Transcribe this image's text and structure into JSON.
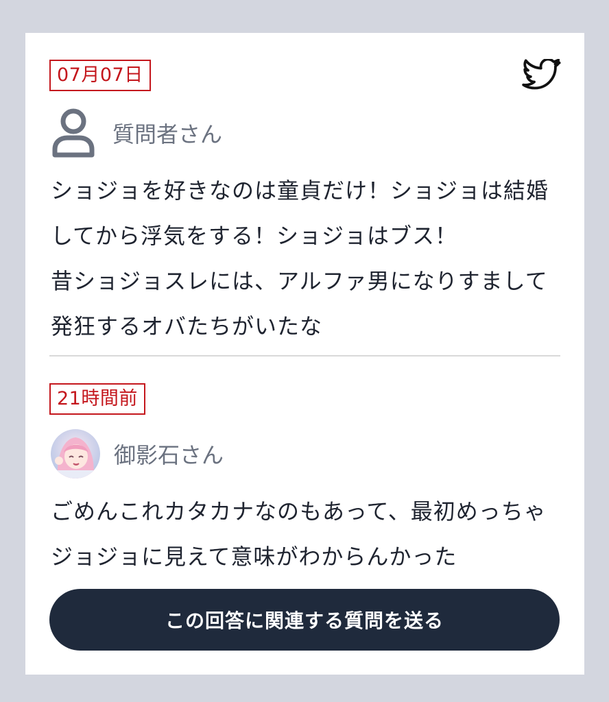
{
  "question": {
    "date": "07月07日",
    "username": "質問者さん",
    "text": "ショジョを好きなのは童貞だけ！ショジョは結婚してから浮気をする！ショジョはブス！\n昔ショジョスレには、アルファ男になりすまして発狂するオバたちがいたな"
  },
  "answer": {
    "date": "21時間前",
    "username": "御影石さん",
    "text": "ごめんこれカタカナなのもあって、最初めっちゃジョジョに見えて意味がわからんかった"
  },
  "share": {
    "icon": "twitter-icon"
  },
  "cta": {
    "label": "この回答に関連する質問を送る"
  },
  "colors": {
    "accent_red": "#c4161c",
    "button_bg": "#1f2a3c",
    "page_bg": "#d3d6df",
    "muted_text": "#6b7280"
  }
}
